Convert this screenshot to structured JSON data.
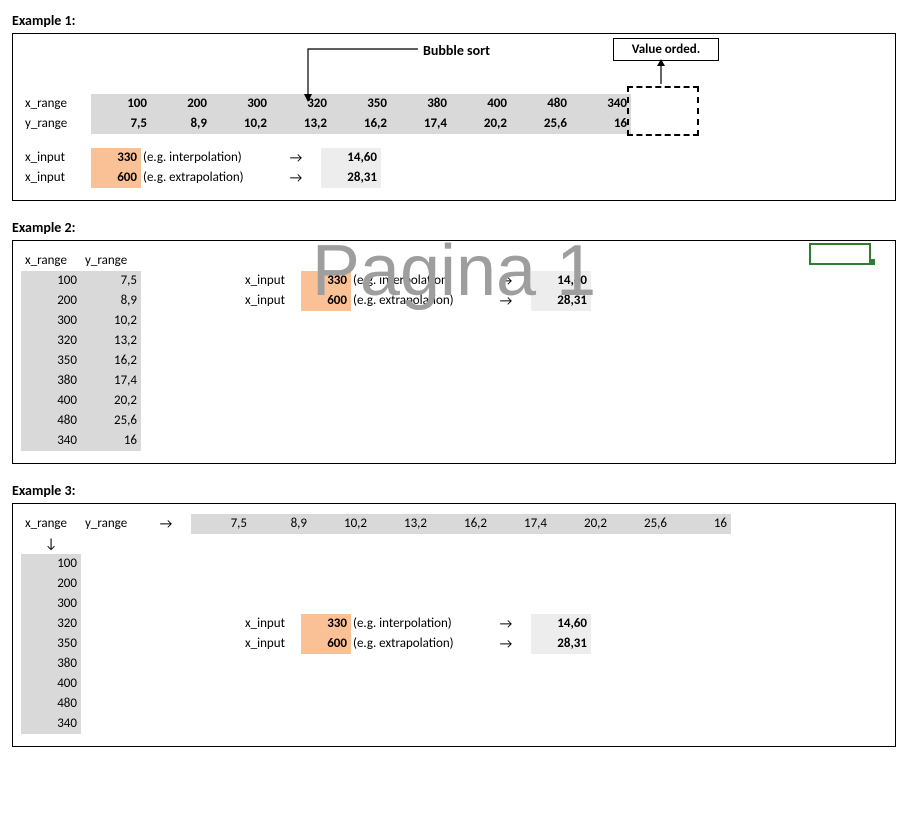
{
  "watermark": "Pagina 1",
  "labels": {
    "x_range": "x_range",
    "y_range": "y_range",
    "x_input": "x_input",
    "interp": "(e.g. interpolation)",
    "extrap": "(e.g. extrapolation)",
    "arrow_r": "→",
    "arrow_d": "↓",
    "bubble": "Bubble sort",
    "value_orded": "Value orded."
  },
  "ex1": {
    "title": "Example 1:",
    "x": [
      "100",
      "200",
      "300",
      "320",
      "350",
      "380",
      "400",
      "480",
      "340"
    ],
    "y": [
      "7,5",
      "8,9",
      "10,2",
      "13,2",
      "16,2",
      "17,4",
      "20,2",
      "25,6",
      "16"
    ],
    "in1_v": "330",
    "in1_r": "14,60",
    "in2_v": "600",
    "in2_r": "28,31"
  },
  "ex2": {
    "title": "Example 2:",
    "rows": [
      {
        "x": "100",
        "y": "7,5"
      },
      {
        "x": "200",
        "y": "8,9"
      },
      {
        "x": "300",
        "y": "10,2"
      },
      {
        "x": "320",
        "y": "13,2"
      },
      {
        "x": "350",
        "y": "16,2"
      },
      {
        "x": "380",
        "y": "17,4"
      },
      {
        "x": "400",
        "y": "20,2"
      },
      {
        "x": "480",
        "y": "25,6"
      },
      {
        "x": "340",
        "y": "16"
      }
    ],
    "in1_v": "330",
    "in1_r": "14,60",
    "in2_v": "600",
    "in2_r": "28,31"
  },
  "ex3": {
    "title": "Example 3:",
    "x": [
      "100",
      "200",
      "300",
      "320",
      "350",
      "380",
      "400",
      "480",
      "340"
    ],
    "y": [
      "7,5",
      "8,9",
      "10,2",
      "13,2",
      "16,2",
      "17,4",
      "20,2",
      "25,6",
      "16"
    ],
    "in1_v": "330",
    "in1_r": "14,60",
    "in2_v": "600",
    "in2_r": "28,31"
  }
}
